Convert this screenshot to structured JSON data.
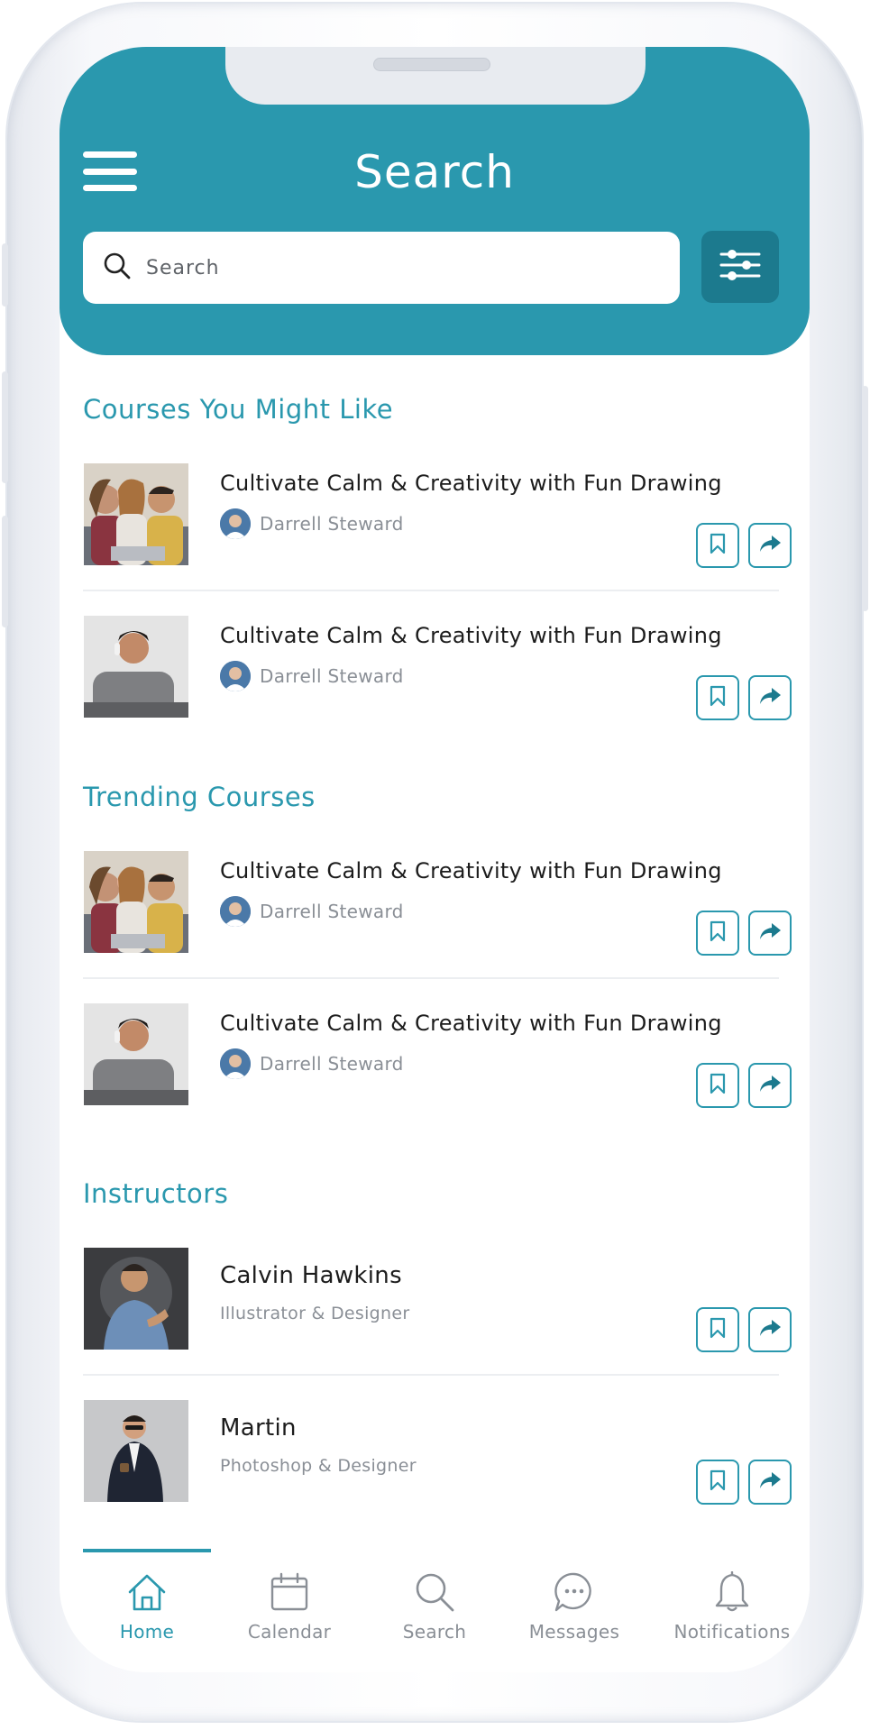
{
  "header": {
    "title": "Search",
    "search_placeholder": "Search"
  },
  "sections": {
    "courses_title": "Courses You Might Like",
    "trending_title": "Trending Courses",
    "instructors_title": "Instructors"
  },
  "courses": [
    {
      "title": "Cultivate Calm & Creativity with Fun Drawing",
      "author": "Darrell Steward",
      "thumb": "group-photo"
    },
    {
      "title": "Cultivate Calm & Creativity with Fun Drawing",
      "author": "Darrell Steward",
      "thumb": "man-headphones-photo"
    }
  ],
  "trending": [
    {
      "title": "Cultivate Calm & Creativity with Fun Drawing",
      "author": "Darrell Steward",
      "thumb": "group-photo"
    },
    {
      "title": "Cultivate Calm & Creativity with Fun Drawing",
      "author": "Darrell Steward",
      "thumb": "man-headphones-photo"
    }
  ],
  "instructors": [
    {
      "name": "Calvin Hawkins",
      "role": "Illustrator & Designer"
    },
    {
      "name": "Martin",
      "role": "Photoshop & Designer"
    }
  ],
  "tabbar": {
    "items": [
      {
        "label": "Home",
        "icon": "home-icon",
        "active": true
      },
      {
        "label": "Calendar",
        "icon": "calendar-icon",
        "active": false
      },
      {
        "label": "Search",
        "icon": "search-icon",
        "active": false
      },
      {
        "label": "Messages",
        "icon": "messages-icon",
        "active": false
      },
      {
        "label": "Notifications",
        "icon": "bell-icon",
        "active": false
      }
    ]
  },
  "colors": {
    "accent": "#2a98ae",
    "accent_dark": "#1c7a8e",
    "text_secondary": "#8a8f96"
  }
}
